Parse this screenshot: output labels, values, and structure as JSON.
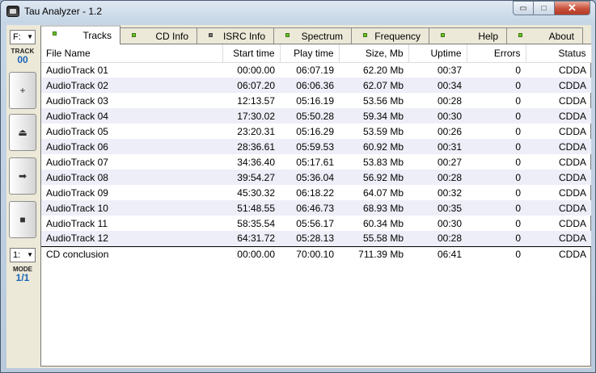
{
  "window": {
    "title": "Tau Analyzer - 1.2",
    "buttons": {
      "minimize": "▭",
      "maximize": "□",
      "close": "✕"
    }
  },
  "sidebar": {
    "drive": "F:",
    "track_label": "TRACK",
    "track_value": "00",
    "buttons": [
      {
        "name": "add",
        "glyph": "+"
      },
      {
        "name": "eject",
        "glyph": "⏏"
      },
      {
        "name": "next",
        "glyph": "➡"
      },
      {
        "name": "stop",
        "glyph": "■"
      }
    ],
    "mode_select": "1:",
    "mode_label": "MODE",
    "mode_value": "1/1"
  },
  "tabs": [
    {
      "label": "Tracks",
      "indicator": "green",
      "active": true
    },
    {
      "label": "CD Info",
      "indicator": "green",
      "active": false
    },
    {
      "label": "ISRC Info",
      "indicator": "gray",
      "active": false
    },
    {
      "label": "Spectrum",
      "indicator": "green",
      "active": false
    },
    {
      "label": "Frequency",
      "indicator": "green",
      "active": false
    },
    {
      "label": "Help",
      "indicator": "green",
      "active": false
    },
    {
      "label": "About",
      "indicator": "green",
      "active": false
    }
  ],
  "table": {
    "columns": [
      "File Name",
      "Start time",
      "Play time",
      "Size, Mb",
      "Uptime",
      "Errors",
      "Status"
    ],
    "rows": [
      [
        "AudioTrack 01",
        "00:00.00",
        "06:07.19",
        "62.20 Mb",
        "00:37",
        "0",
        "CDDA"
      ],
      [
        "AudioTrack 02",
        "06:07.20",
        "06:06.36",
        "62.07 Mb",
        "00:34",
        "0",
        "CDDA"
      ],
      [
        "AudioTrack 03",
        "12:13.57",
        "05:16.19",
        "53.56 Mb",
        "00:28",
        "0",
        "CDDA"
      ],
      [
        "AudioTrack 04",
        "17:30.02",
        "05:50.28",
        "59.34 Mb",
        "00:30",
        "0",
        "CDDA"
      ],
      [
        "AudioTrack 05",
        "23:20.31",
        "05:16.29",
        "53.59 Mb",
        "00:26",
        "0",
        "CDDA"
      ],
      [
        "AudioTrack 06",
        "28:36.61",
        "05:59.53",
        "60.92 Mb",
        "00:31",
        "0",
        "CDDA"
      ],
      [
        "AudioTrack 07",
        "34:36.40",
        "05:17.61",
        "53.83 Mb",
        "00:27",
        "0",
        "CDDA"
      ],
      [
        "AudioTrack 08",
        "39:54.27",
        "05:36.04",
        "56.92 Mb",
        "00:28",
        "0",
        "CDDA"
      ],
      [
        "AudioTrack 09",
        "45:30.32",
        "06:18.22",
        "64.07 Mb",
        "00:32",
        "0",
        "CDDA"
      ],
      [
        "AudioTrack 10",
        "51:48.55",
        "06:46.73",
        "68.93 Mb",
        "00:35",
        "0",
        "CDDA"
      ],
      [
        "AudioTrack 11",
        "58:35.54",
        "05:56.17",
        "60.34 Mb",
        "00:30",
        "0",
        "CDDA"
      ],
      [
        "AudioTrack 12",
        "64:31.72",
        "05:28.13",
        "55.58 Mb",
        "00:28",
        "0",
        "CDDA"
      ]
    ],
    "summary": [
      "CD conclusion",
      "00:00.00",
      "70:00.10",
      "711.39 Mb",
      "06:41",
      "0",
      "CDDA"
    ]
  }
}
